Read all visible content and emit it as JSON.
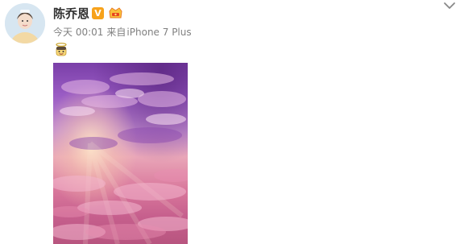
{
  "post": {
    "author": {
      "name": "陈乔恩",
      "verified_badge": "V"
    },
    "time": "今天 00:01",
    "source_prefix": "来自",
    "device": "iPhone 7 Plus",
    "icons": {
      "avatar": "avatar-portrait",
      "member": "member-crown-icon",
      "menu": "chevron-down-icon",
      "emoji": "angel-emoji-icon"
    },
    "colors": {
      "name": "#333333",
      "meta": "#808080",
      "vip_badge": "#f7a21b"
    },
    "image": {
      "subject": "pink and purple sunset clouds"
    }
  }
}
